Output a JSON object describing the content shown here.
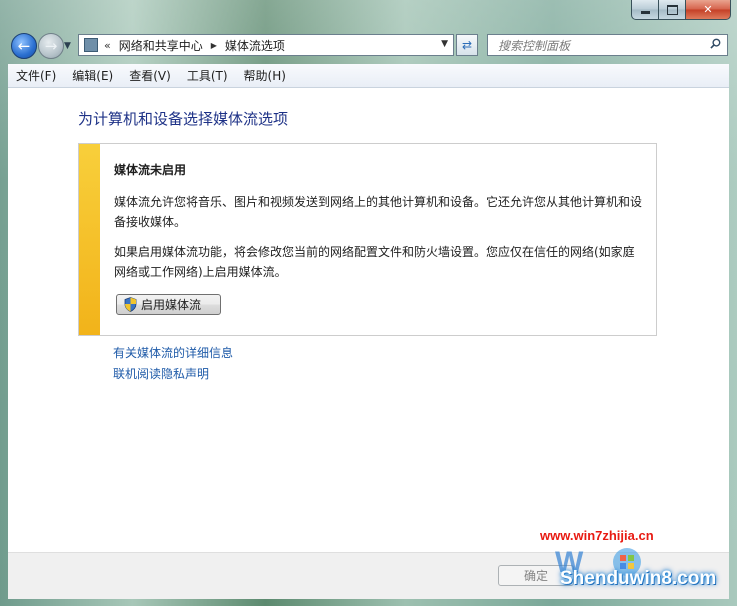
{
  "window": {
    "close_glyph": "✕"
  },
  "address_bar": {
    "overflow": "«",
    "crumbs": [
      "网络和共享中心",
      "媒体流选项"
    ]
  },
  "search": {
    "placeholder": "搜索控制面板"
  },
  "menu": {
    "items": [
      "文件(F)",
      "编辑(E)",
      "查看(V)",
      "工具(T)",
      "帮助(H)"
    ]
  },
  "main": {
    "title": "为计算机和设备选择媒体流选项",
    "panel": {
      "heading": "媒体流未启用",
      "paragraph1": "媒体流允许您将音乐、图片和视频发送到网络上的其他计算机和设备。它还允许您从其他计算机和设备接收媒体。",
      "paragraph2": "如果启用媒体流功能，将会修改您当前的网络配置文件和防火墙设置。您应仅在信任的网络(如家庭网络或工作网络)上启用媒体流。",
      "button_label": "启用媒体流",
      "accent_color": "#f5c02a"
    },
    "links": [
      "有关媒体流的详细信息",
      "联机阅读隐私声明"
    ]
  },
  "footer": {
    "ok_label": "确定"
  },
  "watermark": {
    "url": "www.win7zhijia.cn",
    "brand": "Shenduwin8.com"
  }
}
